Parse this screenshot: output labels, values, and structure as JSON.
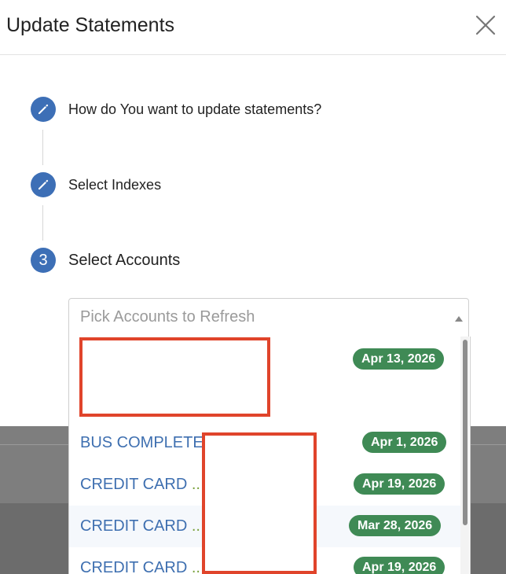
{
  "modal": {
    "title": "Update Statements"
  },
  "steps": [
    {
      "label": "How do You want to update statements?",
      "icon": "pencil-icon",
      "state": "completed"
    },
    {
      "label": "Select Indexes",
      "icon": "pencil-icon",
      "state": "completed"
    },
    {
      "number": "3",
      "label": "Select Accounts",
      "state": "active"
    }
  ],
  "account_select": {
    "placeholder": "Pick Accounts to Refresh",
    "options": [
      {
        "name": "",
        "date": "Apr 13, 2026",
        "redacted": true
      },
      {
        "name": "BUS COMPLETE",
        "date": "Apr 1, 2026"
      },
      {
        "name": "CREDIT CARD",
        "dots": "..",
        "date": "Apr 19, 2026"
      },
      {
        "name": "CREDIT CARD",
        "dots": "..",
        "date": "Mar 28, 2026",
        "highlighted": true
      },
      {
        "name": "CREDIT CARD",
        "dots": "..",
        "date": "Apr 19, 2026"
      }
    ]
  },
  "colors": {
    "step_icon": "#3d6fb6",
    "option_text": "#3e6fb0",
    "date_badge": "#3f8a55",
    "redaction": "#e0442b"
  }
}
